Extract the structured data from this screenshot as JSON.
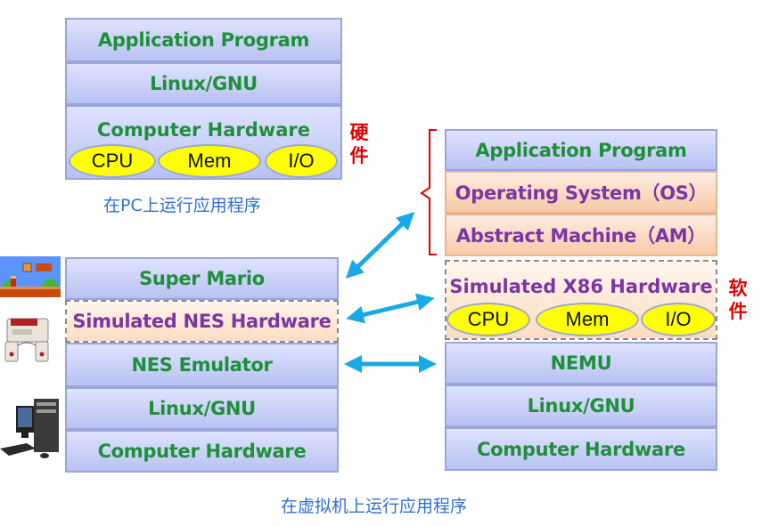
{
  "pc_stack": {
    "layers": [
      "Application Program",
      "Linux/GNU"
    ],
    "hardware": {
      "title": "Computer Hardware",
      "components": [
        "CPU",
        "Mem",
        "I/O"
      ]
    },
    "caption": "在PC上运行应用程序"
  },
  "labels": {
    "hardware": [
      "硬",
      "件"
    ],
    "software": [
      "软",
      "件"
    ]
  },
  "nes_stack": {
    "layers": [
      "Super Mario",
      "Simulated NES Hardware",
      "NES Emulator",
      "Linux/GNU",
      "Computer Hardware"
    ]
  },
  "nemu_stack": {
    "top_layers": [
      "Application Program",
      "Operating System（OS）",
      "Abstract Machine（AM）"
    ],
    "simulated_hw": {
      "title": "Simulated X86 Hardware",
      "components": [
        "CPU",
        "Mem",
        "I/O"
      ]
    },
    "bottom_layers": [
      "NEMU",
      "Linux/GNU",
      "Computer Hardware"
    ]
  },
  "caption": "在虚拟机上运行应用程序",
  "icons": [
    "mario-game-icon",
    "nes-console-icon",
    "desktop-computer-icon"
  ],
  "colors": {
    "layer_text": "#1f8f3a",
    "sim_text": "#7b35a6",
    "caption": "#2f6fd6",
    "arrow": "#19a9e6",
    "label": "#e00000",
    "oval": "#ffff00"
  }
}
